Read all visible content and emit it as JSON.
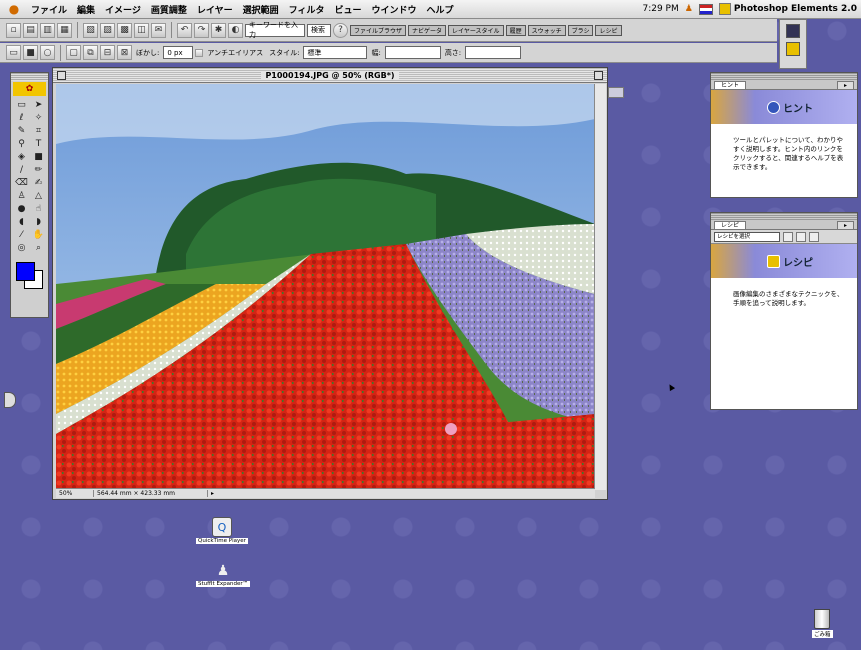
{
  "menubar": {
    "items": [
      "ファイル",
      "編集",
      "イメージ",
      "画質調整",
      "レイヤー",
      "選択範囲",
      "フィルタ",
      "ビュー",
      "ウインドウ",
      "ヘルプ"
    ],
    "clock": "7:29 PM",
    "app_name": "Photoshop Elements 2.0"
  },
  "toolbar": {
    "search_field": "キーワードを入力",
    "search_button": "検索",
    "palette_tabs": [
      "ファイルブラウザ",
      "ナビゲータ",
      "レイヤースタイル",
      "履歴",
      "スウォッチ",
      "ブラシ",
      "レシピ"
    ]
  },
  "options_bar": {
    "feather_label": "ぼかし:",
    "feather_value": "0 px",
    "antialias_label": "アンチエイリアス",
    "style_label": "スタイル:",
    "style_value": "標準",
    "width_label": "幅:",
    "height_label": "高さ:"
  },
  "document": {
    "title": "P1000194.JPG @ 50% (RGB*)",
    "zoom": "50%",
    "size_info": "564.44 mm × 423.33 mm"
  },
  "hint_palette": {
    "tab": "ヒント",
    "title": "ヒント",
    "body": "ツールとパレットについて、わかりやすく説明します。ヒント内のリンクをクリックすると、関連するヘルプを表示できます。"
  },
  "recipe_palette": {
    "tab": "レシピ",
    "select_value": "レシピを選択",
    "title": "レシピ",
    "body": "画像編集のさまざまなテクニックを、手順を追って説明します。"
  },
  "desktop_icons": [
    "QuickTime Player",
    "StuffIt Expander™",
    "ごみ箱"
  ],
  "colors": {
    "foreground": "#0000ff",
    "background": "#ffffff",
    "desktop": "#5a5aa3"
  }
}
